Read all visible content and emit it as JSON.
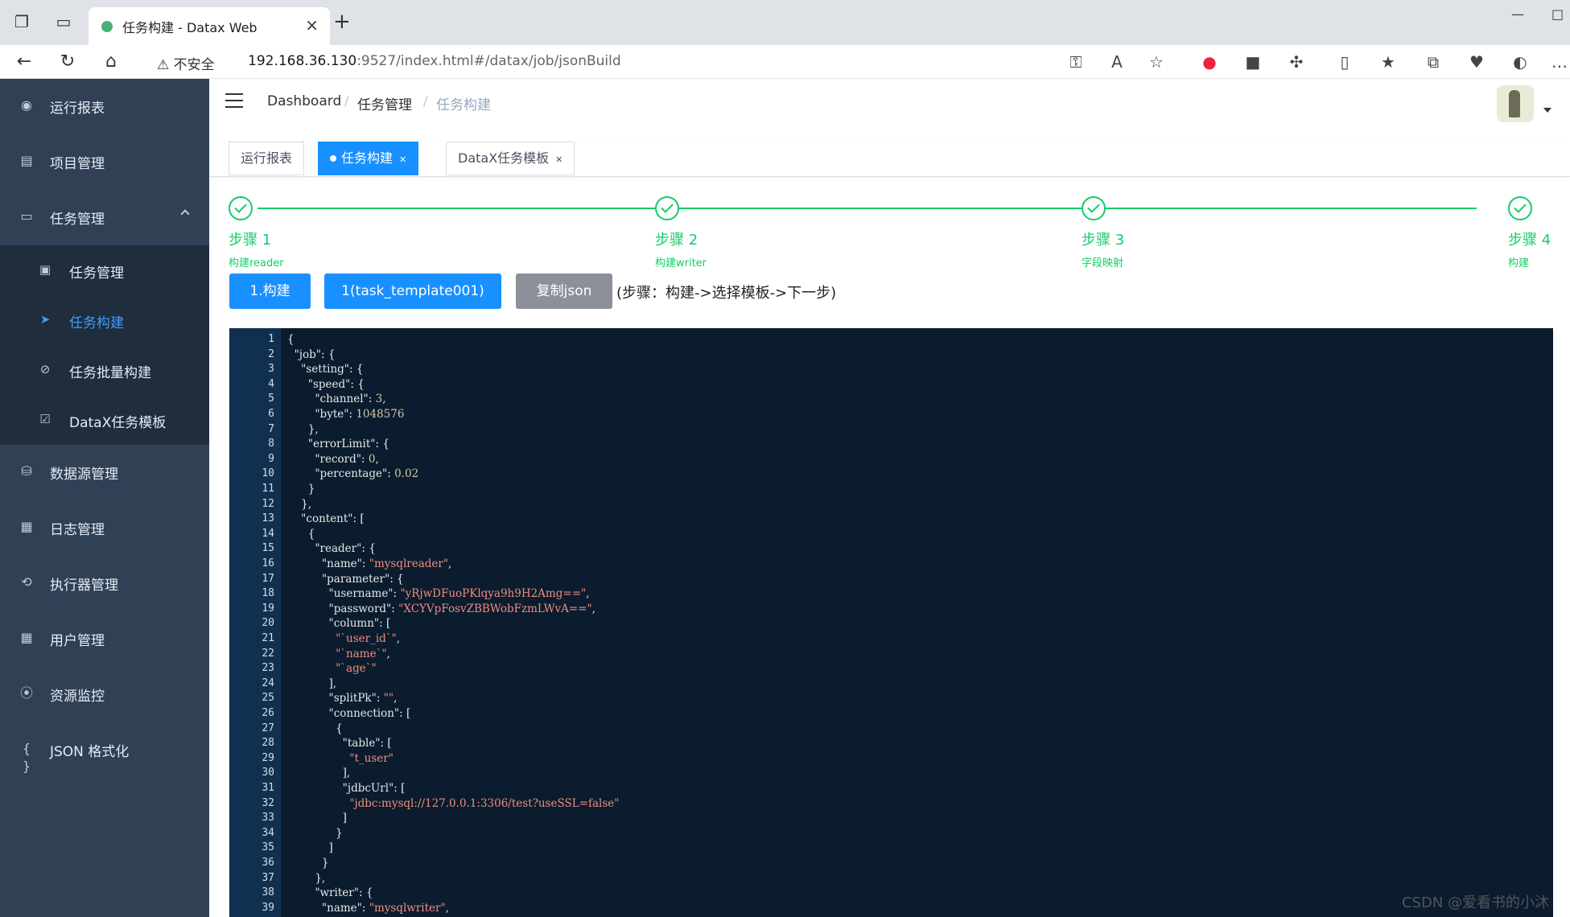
{
  "browser": {
    "tab_title": "任务构建 - Datax Web",
    "security_label": "不安全",
    "url_host": "192.168.36.130",
    "url_rest": ":9527/index.html#/datax/job/jsonBuild"
  },
  "sidebar": {
    "items": [
      {
        "label": "运行报表",
        "icon": "dashboard-icon"
      },
      {
        "label": "项目管理",
        "icon": "project-icon"
      },
      {
        "label": "任务管理",
        "icon": "monitor-icon"
      },
      {
        "label": "数据源管理",
        "icon": "database-icon"
      },
      {
        "label": "日志管理",
        "icon": "log-icon"
      },
      {
        "label": "执行器管理",
        "icon": "executor-icon"
      },
      {
        "label": "用户管理",
        "icon": "users-icon"
      },
      {
        "label": "资源监控",
        "icon": "monitor-resource-icon"
      },
      {
        "label": "JSON 格式化",
        "icon": "json-icon"
      }
    ],
    "sub_items": [
      {
        "label": "任务管理",
        "icon": "task-icon"
      },
      {
        "label": "任务构建",
        "icon": "send-icon"
      },
      {
        "label": "任务批量构建",
        "icon": "batch-icon"
      },
      {
        "label": "DataX任务模板",
        "icon": "template-icon"
      }
    ]
  },
  "breadcrumb": [
    "Dashboard",
    "任务管理",
    "任务构建"
  ],
  "tags": [
    {
      "label": "运行报表"
    },
    {
      "label": "任务构建"
    },
    {
      "label": "DataX任务模板"
    }
  ],
  "steps": [
    {
      "title": "步骤 1",
      "desc": "构建reader"
    },
    {
      "title": "步骤 2",
      "desc": "构建writer"
    },
    {
      "title": "步骤 3",
      "desc": "字段映射"
    },
    {
      "title": "步骤 4",
      "desc": "构建"
    }
  ],
  "buttons": {
    "build": "1.构建",
    "template": "1(task_template001)",
    "copy": "复制json"
  },
  "hint": "(步骤：构建->选择模板->下一步)",
  "code_lines": [
    "{",
    "  \"job\": {",
    "    \"setting\": {",
    "      \"speed\": {",
    "        \"channel\": 3,",
    "        \"byte\": 1048576",
    "      },",
    "      \"errorLimit\": {",
    "        \"record\": 0,",
    "        \"percentage\": 0.02",
    "      }",
    "    },",
    "    \"content\": [",
    "      {",
    "        \"reader\": {",
    "          \"name\": \"mysqlreader\",",
    "          \"parameter\": {",
    "            \"username\": \"yRjwDFuoPKlqya9h9H2Amg==\",",
    "            \"password\": \"XCYVpFosvZBBWobFzmLWvA==\",",
    "            \"column\": [",
    "              \"`user_id`\",",
    "              \"`name`\",",
    "              \"`age`\"",
    "            ],",
    "            \"splitPk\": \"\",",
    "            \"connection\": [",
    "              {",
    "                \"table\": [",
    "                  \"t_user\"",
    "                ],",
    "                \"jdbcUrl\": [",
    "                  \"jdbc:mysql://127.0.0.1:3306/test?useSSL=false\"",
    "                ]",
    "              }",
    "            ]",
    "          }",
    "        },",
    "        \"writer\": {",
    "          \"name\": \"mysqlwriter\","
  ],
  "watermark": "CSDN @爱看书的小沐",
  "colors": {
    "sidebar_bg": "#304156",
    "accent": "#1890ff",
    "step_green": "#13ce66",
    "editor_bg": "#0a1c2e"
  }
}
